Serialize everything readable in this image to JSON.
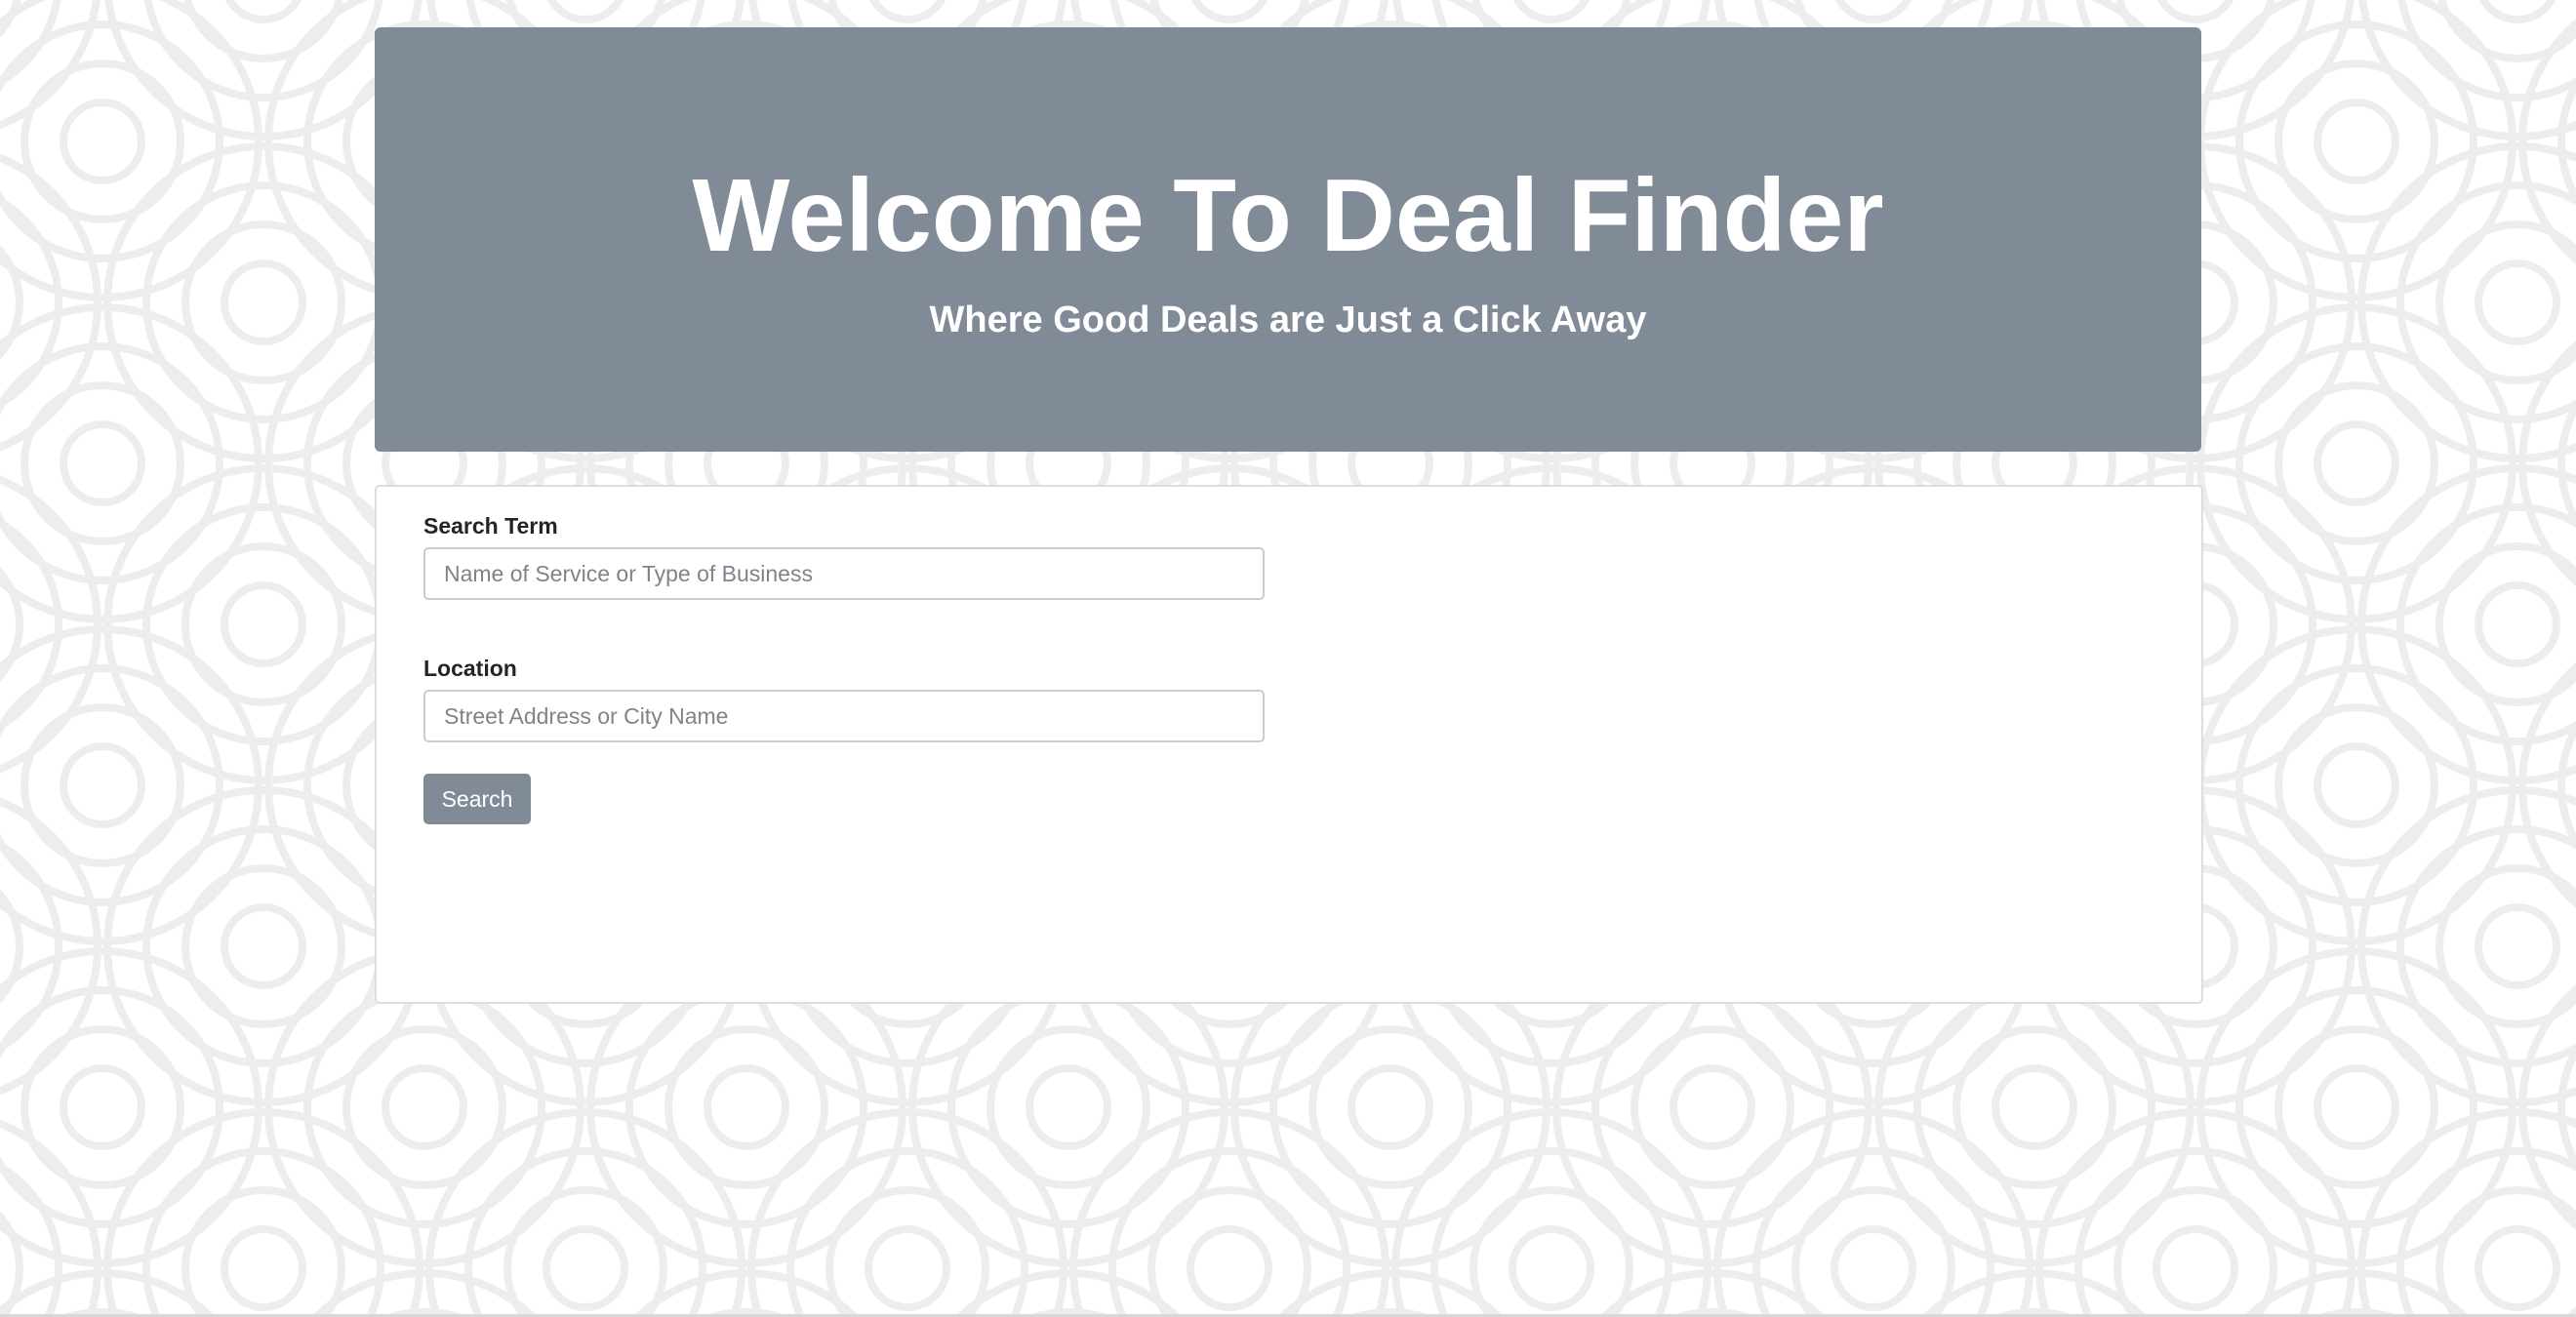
{
  "hero": {
    "title": "Welcome To Deal Finder",
    "subtitle": "Where Good Deals are Just a Click Away"
  },
  "search_form": {
    "term_label": "Search Term",
    "term_placeholder": "Name of Service or Type of Business",
    "term_value": "",
    "location_label": "Location",
    "location_placeholder": "Street Address or City Name",
    "location_value": "",
    "submit_label": "Search"
  },
  "colors": {
    "accent": "#818b97",
    "page_background": "#ffffff",
    "pattern_stroke": "#ededed",
    "card_border": "#dadde1"
  }
}
